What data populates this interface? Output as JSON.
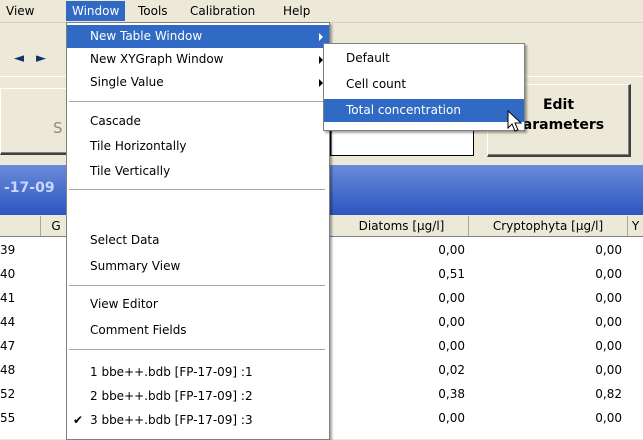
{
  "menubar": {
    "items": [
      "View",
      "Window",
      "Tools",
      "Calibration",
      "Help"
    ]
  },
  "toolbar": {
    "first_btn": "◄",
    "next_btn": "►"
  },
  "panel": {
    "s_label": "S",
    "edit_label": "Edit\nParameters",
    "edit_line1": "Edit",
    "edit_line2": "Parameters"
  },
  "titlebar": {
    "text": "-17-09"
  },
  "grid": {
    "headers": [
      "G",
      "Diatoms [µg/l]",
      "Cryptophyta [µg/l]",
      "Y"
    ],
    "rows": [
      {
        "id": "39",
        "diatoms": "0,00",
        "crypto": "0,00"
      },
      {
        "id": "40",
        "diatoms": "0,51",
        "crypto": "0,00"
      },
      {
        "id": "41",
        "diatoms": "0,00",
        "crypto": "0,00"
      },
      {
        "id": "44",
        "diatoms": "0,00",
        "crypto": "0,00"
      },
      {
        "id": "47",
        "diatoms": "0,00",
        "crypto": "0,00"
      },
      {
        "id": "48",
        "diatoms": "0,02",
        "crypto": "0,00"
      },
      {
        "id": "52",
        "diatoms": "0,38",
        "crypto": "0,82"
      },
      {
        "id": "55",
        "diatoms": "0,00",
        "crypto": "0,00"
      }
    ]
  },
  "window_menu": {
    "items": [
      {
        "label": "New Table Window"
      },
      {
        "label": "New XYGraph Window"
      },
      {
        "label": "Single Value"
      },
      {
        "label": "Cascade"
      },
      {
        "label": "Tile Horizontally"
      },
      {
        "label": "Tile Vertically"
      },
      {
        "label": "Select Data"
      },
      {
        "label": "Summary View"
      },
      {
        "label": "View Editor"
      },
      {
        "label": "Comment Fields"
      },
      {
        "label": "1 bbe++.bdb [FP-17-09] :1"
      },
      {
        "label": "2 bbe++.bdb [FP-17-09] :2"
      },
      {
        "label": "3 bbe++.bdb [FP-17-09] :3"
      }
    ],
    "checkmark": "✔"
  },
  "submenu": {
    "items": [
      {
        "label": "Default"
      },
      {
        "label": "Cell count"
      },
      {
        "label": "Total concentration"
      }
    ]
  },
  "colors": {
    "highlight": "#316ac5",
    "titlebar": "#2c56c0",
    "menubar": "#ece9d8"
  }
}
